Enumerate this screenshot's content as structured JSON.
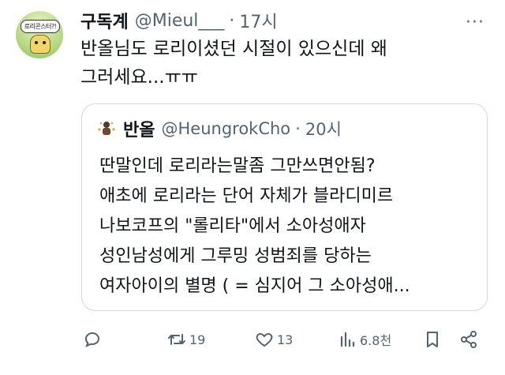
{
  "author": {
    "name": "구독계",
    "handle": "@Mieul___",
    "separator": "·",
    "time": "17시",
    "avatar_text": "로리콘스터?!"
  },
  "tweet": {
    "lines": [
      "반올님도 로리이셨던 시절이 있으신데 왜",
      "그러세요...ㅠㅠ"
    ]
  },
  "quote": {
    "name": "반올",
    "handle": "@HeungrokCho",
    "separator": "·",
    "time": "20시",
    "lines": [
      "딴말인데 로리라는말좀 그만쓰면안됨?",
      "애초에 로리라는 단어 자체가 블라디미르",
      "나보코프의 \"롤리타\"에서 소아성애자",
      "성인남성에게 그루밍 성범죄를 당하는",
      "여자아이의 별명 ( = 심지어 그 소아성애..."
    ]
  },
  "actions": {
    "reply_icon": "reply-icon",
    "retweet_count": "19",
    "like_count": "13",
    "views_count": "6.8천",
    "bookmark_icon": "bookmark-icon",
    "share_icon": "share-icon"
  },
  "more_label": "···"
}
